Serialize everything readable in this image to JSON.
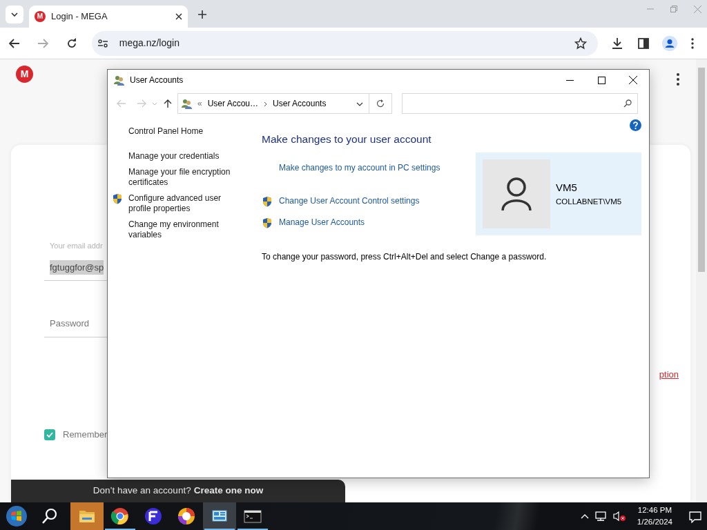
{
  "browser": {
    "tab": {
      "favicon": "M",
      "title": "Login - MEGA",
      "selected": true
    },
    "address": "mega.nz/login"
  },
  "page": {
    "logo": "M",
    "email": {
      "label": "Your email addr",
      "value": "fgtuggfor@sp"
    },
    "password": {
      "placeholder": "Password"
    },
    "link_fragment": "ption",
    "remember": {
      "label": "Remember",
      "checked": true
    },
    "signup": {
      "text": "Don’t have an account?",
      "link": "Create one now"
    }
  },
  "dialog": {
    "title": "User Accounts",
    "breadcrumb": {
      "prefix": "«",
      "items": [
        "User Accou…",
        "User Accounts"
      ]
    },
    "sidebar": [
      {
        "text": "Control Panel Home",
        "shield": false,
        "kind": "home"
      },
      {
        "text": "Manage your credentials",
        "shield": false,
        "kind": "task"
      },
      {
        "text": "Manage your file encryption certificates",
        "shield": false,
        "kind": "task"
      },
      {
        "text": "Configure advanced user profile properties",
        "shield": true,
        "kind": "task"
      },
      {
        "text": "Change my environment variables",
        "shield": false,
        "kind": "task"
      }
    ],
    "heading": "Make changes to your user account",
    "links": [
      {
        "text": "Make changes to my account in PC settings",
        "shield": false
      },
      {
        "text": "Change User Account Control settings",
        "shield": true
      },
      {
        "text": "Manage User Accounts",
        "shield": true
      }
    ],
    "account": {
      "name": "VM5",
      "domain": "COLLABNET\\VM5"
    },
    "note": "To change your password, press Ctrl+Alt+Del and select Change a password."
  },
  "taskbar": {
    "apps": [
      {
        "kind": "start",
        "running": false,
        "flashing": false,
        "selected": false
      },
      {
        "kind": "search",
        "running": false,
        "flashing": false,
        "selected": false
      },
      {
        "kind": "explorer",
        "running": false,
        "flashing": true,
        "selected": false
      },
      {
        "kind": "chrome",
        "running": true,
        "flashing": false,
        "selected": false
      },
      {
        "kind": "fapp",
        "running": false,
        "flashing": false,
        "selected": false
      },
      {
        "kind": "ring",
        "running": false,
        "flashing": false,
        "selected": false
      },
      {
        "kind": "control-panel",
        "running": true,
        "flashing": false,
        "selected": true
      },
      {
        "kind": "terminal",
        "running": true,
        "flashing": false,
        "selected": false
      }
    ],
    "volume": {
      "muted": true
    },
    "time": "12:46 PM",
    "date": "1/26/2024"
  }
}
